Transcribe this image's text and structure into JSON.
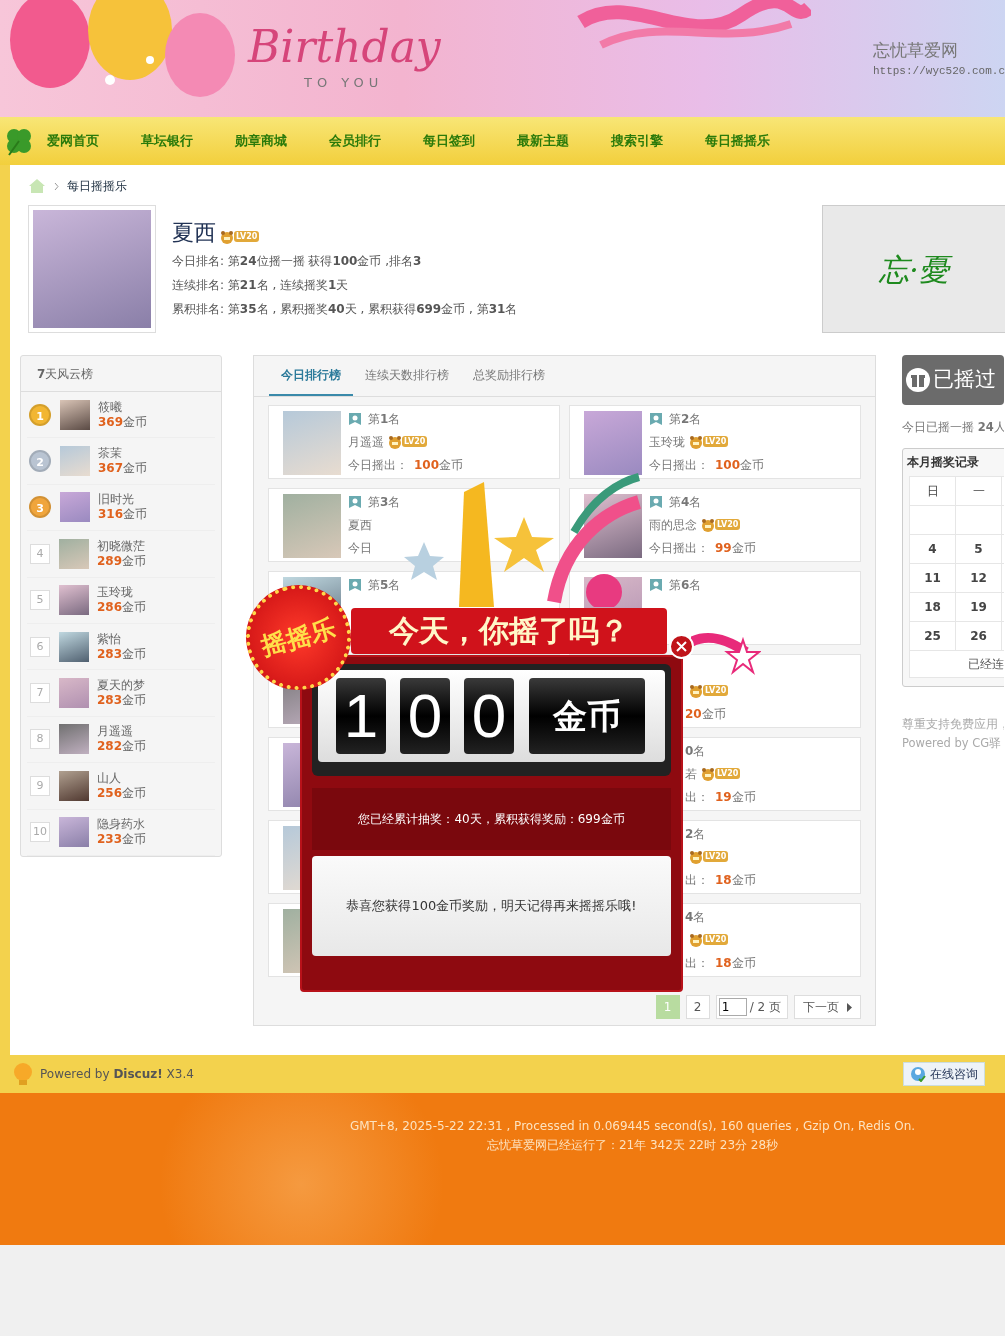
{
  "banner": {
    "title": "Birthday",
    "subtitle": "TO YOU",
    "site_name": "忘忧草爱网",
    "site_url": "https://wyc520.com.c"
  },
  "nav": [
    {
      "label": "爱网首页"
    },
    {
      "label": "草坛银行"
    },
    {
      "label": "勋章商城"
    },
    {
      "label": "会员排行"
    },
    {
      "label": "每日签到"
    },
    {
      "label": "最新主题"
    },
    {
      "label": "搜索引擎"
    },
    {
      "label": "每日摇摇乐"
    }
  ],
  "breadcrumb": "每日摇摇乐",
  "profile": {
    "name": "夏西",
    "badge": "LV20",
    "lines": [
      "今日排名: 第**24**位摇一摇 获得**100**金币 ,排名**3**",
      "连续排名: 第**21**名 , 连续摇奖**1**天",
      "累积排名: 第**35**名 , 累积摇奖**40**天 , 累积获得**699**金币 , 第**31**名"
    ]
  },
  "ad": {
    "text": "忘·憂"
  },
  "weekly": {
    "title": "**7**天风云榜",
    "items": [
      {
        "rank": "1",
        "kind": "medal",
        "color": "#f2b632",
        "name": "筱曦",
        "coins": "369",
        "unit": "金币"
      },
      {
        "rank": "2",
        "kind": "medal",
        "color": "#b9c4d2",
        "name": "茶茉",
        "coins": "367",
        "unit": "金币"
      },
      {
        "rank": "3",
        "kind": "medal",
        "color": "#f0a53c",
        "name": "旧时光",
        "coins": "316",
        "unit": "金币"
      },
      {
        "rank": "4",
        "kind": "plain",
        "name": "初晓微茫",
        "coins": "289",
        "unit": "金币"
      },
      {
        "rank": "5",
        "kind": "plain",
        "name": "玉玲珑",
        "coins": "286",
        "unit": "金币"
      },
      {
        "rank": "6",
        "kind": "plain",
        "name": "紫怡",
        "coins": "283",
        "unit": "金币"
      },
      {
        "rank": "7",
        "kind": "plain",
        "name": "夏天的梦",
        "coins": "283",
        "unit": "金币"
      },
      {
        "rank": "8",
        "kind": "plain",
        "name": "月遥遥",
        "coins": "282",
        "unit": "金币"
      },
      {
        "rank": "9",
        "kind": "plain",
        "name": "山人",
        "coins": "256",
        "unit": "金币"
      },
      {
        "rank": "10",
        "kind": "plain",
        "name": "隐身药水",
        "coins": "233",
        "unit": "金币"
      }
    ]
  },
  "tabs": [
    {
      "label": "今日排行榜",
      "selected": true
    },
    {
      "label": "连续天数排行榜",
      "selected": false
    },
    {
      "label": "总奖励排行榜",
      "selected": false
    }
  ],
  "cards": [
    {
      "kind": "full",
      "rank": "第**1**名",
      "name": "月遥遥",
      "badge": "LV20",
      "label": "今日摇出：",
      "coins": "100",
      "unit": "金币"
    },
    {
      "kind": "full",
      "rank": "第**2**名",
      "name": "玉玲珑",
      "badge": "LV20",
      "label": "今日摇出：",
      "coins": "100",
      "unit": "金币"
    },
    {
      "kind": "full",
      "rank": "第**3**名",
      "name": "夏西",
      "label": "今日"
    },
    {
      "kind": "full",
      "rank": "第**4**名",
      "name": "雨的思念",
      "badge": "LV20",
      "label": "今日摇出：",
      "coins": "99",
      "unit": "金币"
    },
    {
      "kind": "full",
      "rank": "第**5**名"
    },
    {
      "kind": "full",
      "rank": "第**6**名"
    },
    {
      "kind": "covered"
    },
    {
      "kind": "offset",
      "badge": "LV20",
      "coins": "20",
      "unit": "金币"
    },
    {
      "kind": "covered"
    },
    {
      "kind": "offset",
      "rank": "**0**名",
      "name": "若",
      "badge": "LV20",
      "label": "出：",
      "coins": "19",
      "unit": "金币"
    },
    {
      "kind": "covered"
    },
    {
      "kind": "offset",
      "rank": "**2**名",
      "badge": "LV20",
      "label": "出：",
      "coins": "18",
      "unit": "金币"
    },
    {
      "kind": "covered"
    },
    {
      "kind": "offset",
      "rank": "**4**名",
      "badge": "LV20",
      "label": "出：",
      "coins": "18",
      "unit": "金币"
    }
  ],
  "pagination": {
    "pages": [
      {
        "label": "1",
        "selected": true
      },
      {
        "label": "2",
        "selected": false
      }
    ],
    "page_input": "1",
    "page_total": "/ 2 页",
    "next": "下一页"
  },
  "popup": {
    "badge": "摇摇乐",
    "headline": "今天，你摇了吗？",
    "digits": [
      "1",
      "0",
      "0"
    ],
    "unit": "金币",
    "summary": "您已经累计抽奖：40天，累积获得奖励：699金币",
    "message": "恭喜您获得100金币奖励，明天记得再来摇摇乐哦!"
  },
  "sidebar": {
    "shake_button": "已摇过",
    "today_count": "今日已摇一摇 **24**人",
    "calendar": {
      "title": "本月摇奖记录",
      "headers": [
        "日",
        "一"
      ],
      "rows": [
        [
          null,
          null
        ],
        [
          "4",
          "5"
        ],
        [
          "11",
          "12"
        ],
        [
          "18",
          "19"
        ],
        [
          "25",
          "26"
        ]
      ],
      "footer": "已经连"
    },
    "notes": [
      "尊重支持免费应用，",
      "Powered by CG驿"
    ]
  },
  "footer": {
    "powered": "Powered by **Discuz!** X3.4",
    "consult_button": "在线咨询",
    "stats": [
      "GMT+8, 2025-5-22 22:31 , Processed in 0.069445 second(s), 160 queries , Gzip On, Redis On.",
      "忘忧草爱网已经运行了：21年 342天 22时 23分 28秒"
    ]
  }
}
